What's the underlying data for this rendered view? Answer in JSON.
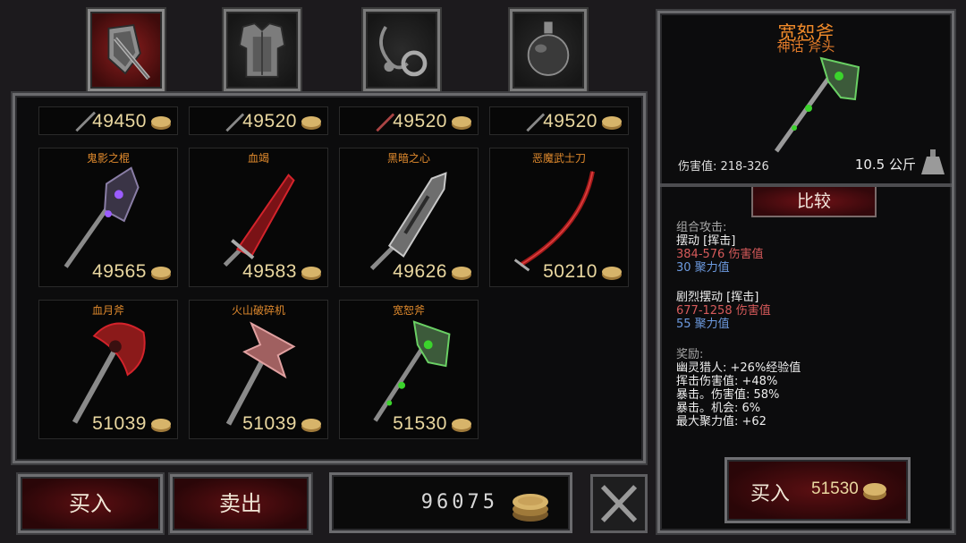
{
  "tabs": [
    {
      "icon": "armor-sword-icon",
      "active": true
    },
    {
      "icon": "chest-armor-icon",
      "active": false
    },
    {
      "icon": "ring-amulet-icon",
      "active": false
    },
    {
      "icon": "potion-icon",
      "active": false
    }
  ],
  "top_row": [
    {
      "price": "49450"
    },
    {
      "price": "49520"
    },
    {
      "price": "49520"
    },
    {
      "price": "49520"
    }
  ],
  "items": [
    {
      "name": "鬼影之棍",
      "price": "49565",
      "icon": "ghost-staff-icon",
      "glow": "#9b5cff"
    },
    {
      "name": "血竭",
      "price": "49583",
      "icon": "blood-sword-icon",
      "glow": "#d4232b"
    },
    {
      "name": "黑暗之心",
      "price": "49626",
      "icon": "dark-heart-blade-icon",
      "glow": "#bfbfbf"
    },
    {
      "name": "恶魔武士刀",
      "price": "50210",
      "icon": "demon-katana-icon",
      "glow": "#c21b1b"
    },
    {
      "name": "血月斧",
      "price": "51039",
      "icon": "blood-moon-axe-icon",
      "glow": "#d4232b"
    },
    {
      "name": "火山破碎机",
      "price": "51039",
      "icon": "volcano-crusher-icon",
      "glow": "#e07a7a"
    },
    {
      "name": "宽恕斧",
      "price": "51530",
      "icon": "forgiveness-axe-icon",
      "glow": "#3bd42c"
    }
  ],
  "buttons": {
    "buy": "买入",
    "sell": "卖出"
  },
  "gold": "96075",
  "detail": {
    "title": "宽恕斧",
    "subtitle": "神话 斧头",
    "damage": "伤害值: 218-326",
    "weight": "10.5 公斤",
    "compare": "比较",
    "combo_header": "组合攻击:",
    "attack1_name": "摆动 [挥击]",
    "attack1_damage": "384-576 伤害值",
    "attack1_focus": "30 聚力值",
    "attack2_name": "剧烈摆动 [挥击]",
    "attack2_damage": "677-1258 伤害值",
    "attack2_focus": "55 聚力值",
    "bonus_header": "奖励:",
    "bonuses": [
      "幽灵猎人: +26%经验值",
      "挥击伤害值: +48%",
      "暴击。伤害值: 58%",
      "暴击。机会: 6%",
      "最大聚力值: +62"
    ],
    "buy_label": "买入",
    "buy_price": "51530"
  },
  "colors": {
    "accent_orange": "#e08a2d",
    "price_gold": "#e9d7a0",
    "damage_red": "#d65a5a",
    "focus_blue": "#6d9be0"
  }
}
